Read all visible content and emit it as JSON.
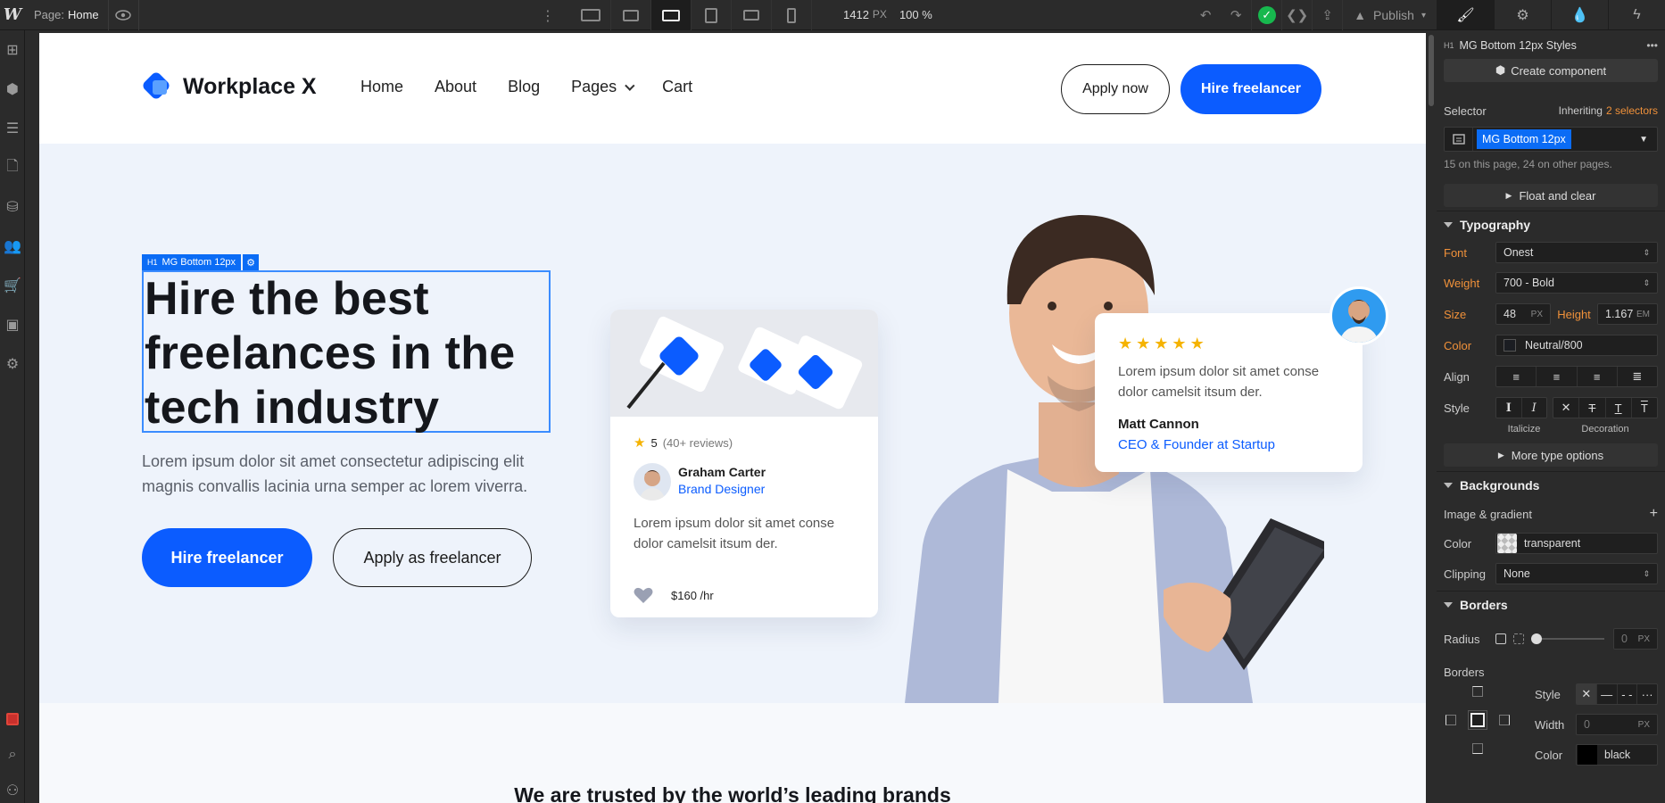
{
  "topbar": {
    "logo": "W",
    "page_key": "Page:",
    "page_name": "Home",
    "canvas_width": "1412",
    "canvas_unit": "PX",
    "zoom": "100 %",
    "publish_label": "Publish"
  },
  "site": {
    "brand": "Workplace X",
    "nav": [
      "Home",
      "About",
      "Blog",
      "Pages",
      "Cart"
    ],
    "apply_now": "Apply now",
    "hire_freelancer": "Hire freelancer"
  },
  "hero": {
    "selection_tag": "MG Bottom 12px",
    "selection_tag_type": "H1",
    "headline": "Hire the best freelances in the tech industry",
    "paragraph": "Lorem ipsum dolor sit amet consectetur adipiscing elit magnis convallis lacinia urna semper ac lorem viverra.",
    "primary_btn": "Hire freelancer",
    "secondary_btn": "Apply as freelancer"
  },
  "card1": {
    "rating": "5",
    "reviews": "(40+ reviews)",
    "name": "Graham Carter",
    "role": "Brand Designer",
    "text": "Lorem ipsum dolor sit amet conse dolor camelsit itsum der.",
    "price": "$160 /hr"
  },
  "card2": {
    "stars": 5,
    "text": "Lorem ipsum dolor sit amet conse dolor camelsit itsum der.",
    "name": "Matt Cannon",
    "role": "CEO & Founder at Startup"
  },
  "trusted_heading": "We are trusted by the world’s leading brands",
  "panel": {
    "style_tag": "H1",
    "style_name": "MG Bottom 12px Styles",
    "create_component": "Create component",
    "selector_label": "Selector",
    "inheriting": "Inheriting",
    "inheriting_count": "2 selectors",
    "selector_chip": "MG Bottom 12px",
    "usage_note": "15 on this page, 24 on other pages.",
    "float_clear": "Float and clear",
    "typography": "Typography",
    "font_label": "Font",
    "font_value": "Onest",
    "weight_label": "Weight",
    "weight_value": "700 - Bold",
    "size_label": "Size",
    "size_value": "48",
    "size_unit": "PX",
    "height_label": "Height",
    "height_value": "1.167",
    "height_unit": "EM",
    "color_label": "Color",
    "color_value": "Neutral/800",
    "align_label": "Align",
    "style_label": "Style",
    "italicize": "Italicize",
    "decoration": "Decoration",
    "more_type": "More type options",
    "backgrounds": "Backgrounds",
    "image_gradient": "Image & gradient",
    "bg_color_label": "Color",
    "bg_color_value": "transparent",
    "clipping_label": "Clipping",
    "clipping_value": "None",
    "borders": "Borders",
    "radius_label": "Radius",
    "radius_value": "0",
    "radius_unit": "PX",
    "borders_label": "Borders",
    "b_style_label": "Style",
    "b_width_label": "Width",
    "b_width_value": "0",
    "b_width_unit": "PX",
    "b_color_label": "Color",
    "b_color_value": "black"
  },
  "colors": {
    "accent": "#0b5cff",
    "selection": "#0b6cf5",
    "star": "#f5b301",
    "label_orange": "#f0913a",
    "success": "#17b84e"
  }
}
